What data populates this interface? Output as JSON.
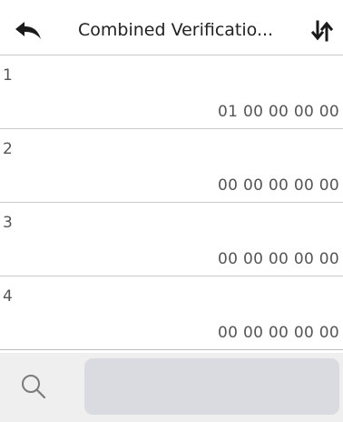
{
  "header": {
    "title": "Combined Verificatio...",
    "back_icon": "back-arrow-icon",
    "sort_icon": "sort-icon"
  },
  "list": {
    "items": [
      {
        "index": "1",
        "value": "01 00 00 00 00"
      },
      {
        "index": "2",
        "value": "00 00 00 00 00"
      },
      {
        "index": "3",
        "value": "00 00 00 00 00"
      },
      {
        "index": "4",
        "value": "00 00 00 00 00"
      }
    ]
  },
  "footer": {
    "search_icon": "search-icon",
    "search_value": ""
  },
  "colors": {
    "background": "#ffffff",
    "footer_background": "#efefef",
    "search_box": "#dadbe0",
    "divider": "#c9c9c9",
    "text": "#555555"
  }
}
